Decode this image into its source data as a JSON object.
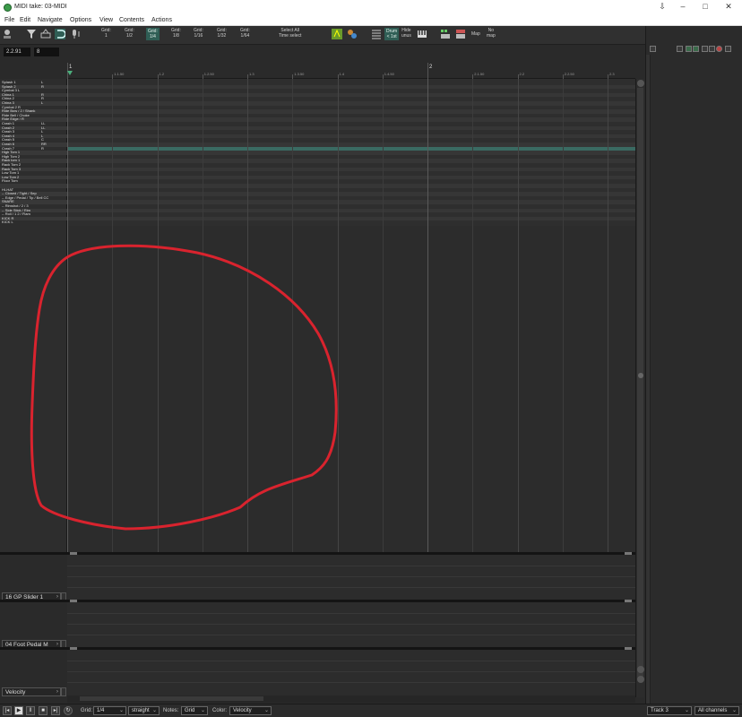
{
  "window": {
    "title": "MIDI take: 03-MIDI",
    "controls": [
      "⇩",
      "–",
      "□",
      "✕"
    ]
  },
  "menu": [
    "File",
    "Edit",
    "Navigate",
    "Options",
    "View",
    "Contents",
    "Actions"
  ],
  "toolbar": {
    "grid_buttons": [
      {
        "line1": "Grid:",
        "line2": "1",
        "active": false
      },
      {
        "line1": "Grid:",
        "line2": "1/2",
        "active": false
      },
      {
        "line1": "Grid:",
        "line2": "1/4",
        "active": true
      },
      {
        "line1": "Grid:",
        "line2": "1/8",
        "active": false
      },
      {
        "line1": "Grid:",
        "line2": "1/16",
        "active": false
      },
      {
        "line1": "Grid:",
        "line2": "1/32",
        "active": false
      },
      {
        "line1": "Grid:",
        "line2": "1/64",
        "active": false
      }
    ],
    "select_all": {
      "line1": "Select All",
      "line2": "Time select"
    },
    "drum_btn": {
      "line1": "Drum",
      "line2": "< 1st"
    },
    "hide_unused": {
      "line1": "Hide",
      "line2": "unus"
    },
    "map_btn": "Map",
    "no_map": {
      "line1": "No",
      "line2": "map"
    }
  },
  "position": {
    "time": "2.2.91",
    "length": "8"
  },
  "ruler": {
    "major": [
      "1",
      "2"
    ],
    "minor": [
      "1.1.50",
      "1.2",
      "1.2.50",
      "1.3",
      "1.3.50",
      "1.4",
      "1.4.50",
      "2.1.50",
      "2.2",
      "2.2.50",
      "2.3"
    ]
  },
  "note_names": [
    {
      "name": "Splash 1",
      "suf": "L"
    },
    {
      "name": "Splash 2",
      "suf": "R"
    },
    {
      "name": "Cymbal 3 L",
      "suf": ""
    },
    {
      "name": "China 1",
      "suf": "R"
    },
    {
      "name": "China 2",
      "suf": "R"
    },
    {
      "name": "China 3",
      "suf": "L"
    },
    {
      "name": "Cymbal 2 R",
      "suf": ""
    },
    {
      "name": "Ride Bow / 2 / Shank",
      "suf": ""
    },
    {
      "name": "Ride Bell / Choke",
      "suf": ""
    },
    {
      "name": "Ride Edge / R",
      "suf": ""
    },
    {
      "name": "Crash 1",
      "suf": "LL"
    },
    {
      "name": "Crash 2",
      "suf": "LL"
    },
    {
      "name": "Crash 3",
      "suf": "L"
    },
    {
      "name": "Crash 4",
      "suf": "L"
    },
    {
      "name": "Crash 5",
      "suf": "C"
    },
    {
      "name": "Crash 6",
      "suf": "RR"
    },
    {
      "name": "Crash 7",
      "suf": "R"
    },
    {
      "name": "High Tom 1",
      "suf": ""
    },
    {
      "name": "High Tom 2",
      "suf": ""
    },
    {
      "name": "Rack tom 1",
      "suf": ""
    },
    {
      "name": "Rack Tom 2",
      "suf": ""
    },
    {
      "name": "Rack Tom 3",
      "suf": ""
    },
    {
      "name": "Low Tom 1",
      "suf": ""
    },
    {
      "name": "Low Tom 2",
      "suf": ""
    },
    {
      "name": "Floor Tom",
      "suf": ""
    },
    {
      "name": "",
      "suf": ""
    },
    {
      "name": "HI-HAT",
      "suf": ""
    },
    {
      "name": "-- Closed / Tight / Sep",
      "suf": ""
    },
    {
      "name": "-- Edge / Pedal / Tip / Bell CC",
      "suf": ""
    },
    {
      "name": "SNARE",
      "suf": ""
    },
    {
      "name": "-- Rimshot / 2 / 3",
      "suf": ""
    },
    {
      "name": "-- Side Stick / Rim",
      "suf": ""
    },
    {
      "name": "-- Roll / 1 2 / Flam",
      "suf": ""
    },
    {
      "name": "KICK R",
      "suf": ""
    },
    {
      "name": "KICK L",
      "suf": ""
    }
  ],
  "cc_lanes": [
    {
      "label": "16 GP Slider 1"
    },
    {
      "label": "04 Foot Pedal M"
    },
    {
      "label": "Velocity"
    }
  ],
  "bottom": {
    "grid_label": "Grid:",
    "grid_value": "1/4",
    "grid_type": "straight",
    "notes_label": "Notes:",
    "notes_value": "Grid",
    "color_label": "Color:",
    "color_value": "Velocity",
    "track": "Track 3",
    "channels": "All channels"
  },
  "colors": {
    "annotation": "#d9232e",
    "accent": "#2f5e55",
    "highlight_lane": "#3a6a62"
  }
}
